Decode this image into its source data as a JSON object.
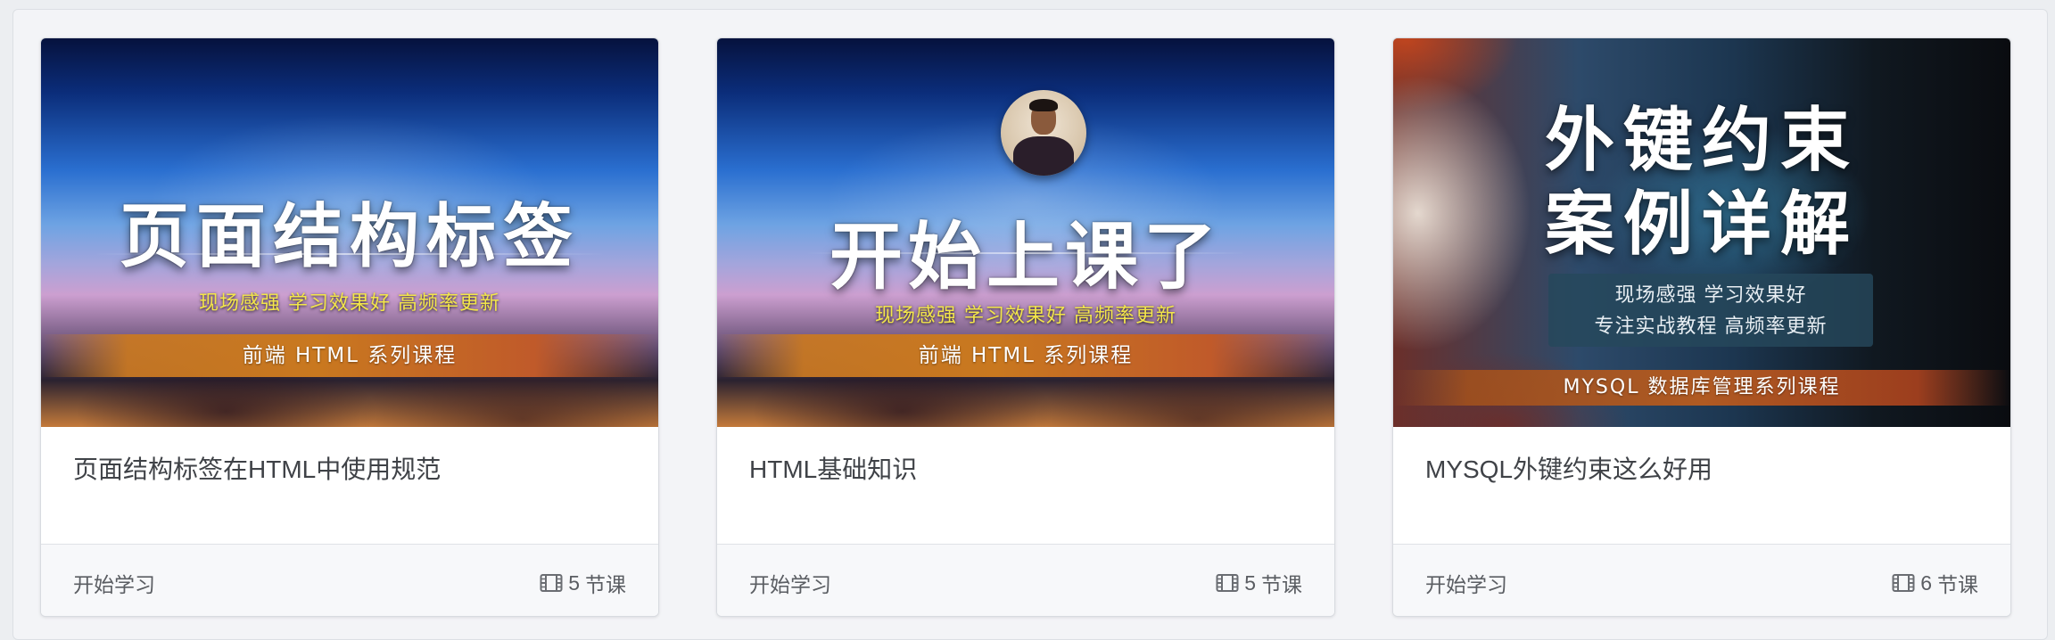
{
  "courses": [
    {
      "cover": {
        "title": "页面结构标签",
        "tagline": "现场感强 学习效果好 高频率更新",
        "ribbon": "前端 HTML 系列课程"
      },
      "title": "页面结构标签在HTML中使用规范",
      "action_label": "开始学习",
      "lesson_count": "5",
      "lesson_unit": "节课",
      "icon": "film-icon"
    },
    {
      "cover": {
        "title": "开始上课了",
        "tagline": "现场感强 学习效果好 高频率更新",
        "ribbon": "前端 HTML 系列课程"
      },
      "title": "HTML基础知识",
      "action_label": "开始学习",
      "lesson_count": "5",
      "lesson_unit": "节课",
      "icon": "film-icon"
    },
    {
      "cover": {
        "title_line1": "外键约束",
        "title_line2": "案例详解",
        "info_line1": "现场感强  学习效果好",
        "info_line2": "专注实战教程  高频率更新",
        "ribbon": "MYSQL 数据库管理系列课程"
      },
      "title": "MYSQL外键约束这么好用",
      "action_label": "开始学习",
      "lesson_count": "6",
      "lesson_unit": "节课",
      "icon": "film-icon"
    }
  ],
  "colors": {
    "tagline_yellow": "#f3e64a",
    "ribbon_orange": "#c9781f",
    "title_text": "#3f4247",
    "footer_text": "#5a5d62"
  }
}
